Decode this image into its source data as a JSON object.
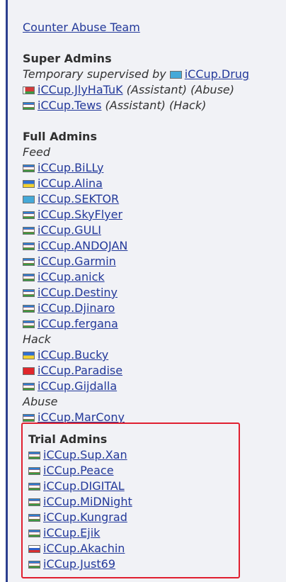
{
  "title": "Counter Abuse Team",
  "super_admins": {
    "heading": "Super Admins",
    "supervised_prefix": "Temporary supervised by",
    "supervisor": {
      "name": "iCCup.Drug",
      "flag": "kz"
    },
    "members": [
      {
        "name": "iCCup.JlyHaTuK",
        "flag": "by",
        "note": "(Assistant) (Abuse)"
      },
      {
        "name": "iCCup.Tews",
        "flag": "uz",
        "note": "(Assistant) (Hack)"
      }
    ]
  },
  "full_admins": {
    "heading": "Full Admins",
    "groups": [
      {
        "label": "Feed",
        "members": [
          {
            "name": "iCCup.BiLLy",
            "flag": "uz"
          },
          {
            "name": "iCCup.Alina",
            "flag": "ua"
          },
          {
            "name": "iCCup.SEKTOR",
            "flag": "kz"
          },
          {
            "name": "iCCup.SkyFlyer",
            "flag": "uz"
          },
          {
            "name": "iCCup.GULI",
            "flag": "uz"
          },
          {
            "name": "iCCup.ANDOJAN",
            "flag": "uz"
          },
          {
            "name": "iCCup.Garmin",
            "flag": "uz"
          },
          {
            "name": "iCCup.anick",
            "flag": "uz"
          },
          {
            "name": "iCCup.Destiny",
            "flag": "uz"
          },
          {
            "name": "iCCup.Djinaro",
            "flag": "uz"
          },
          {
            "name": "iCCup.fergana",
            "flag": "uz"
          }
        ]
      },
      {
        "label": "Hack",
        "members": [
          {
            "name": "iCCup.Bucky",
            "flag": "ua"
          },
          {
            "name": "iCCup.Paradise",
            "flag": "tr"
          },
          {
            "name": "iCCup.Gijdalla",
            "flag": "uz"
          }
        ]
      },
      {
        "label": "Abuse",
        "members": [
          {
            "name": "iCCup.MarCony",
            "flag": "uz"
          }
        ]
      }
    ]
  },
  "trial_admins": {
    "heading": "Trial Admins",
    "members": [
      {
        "name": "iCCup.Sup.Xan",
        "flag": "uz"
      },
      {
        "name": "iCCup.Peace",
        "flag": "uz"
      },
      {
        "name": "iCCup.DIGITAL",
        "flag": "uz"
      },
      {
        "name": "iCCup.MiDNight",
        "flag": "uz"
      },
      {
        "name": "iCCup.Kungrad",
        "flag": "uz"
      },
      {
        "name": "iCCup.Ejik",
        "flag": "uz"
      },
      {
        "name": "iCCup.Akachin",
        "flag": "ru"
      },
      {
        "name": "iCCup.Just69",
        "flag": "uz"
      }
    ]
  },
  "colors": {
    "link": "#23399a",
    "highlight_border": "#e02030",
    "panel_background": "#f1f2f6",
    "accent_bar": "#2c3f8f"
  }
}
